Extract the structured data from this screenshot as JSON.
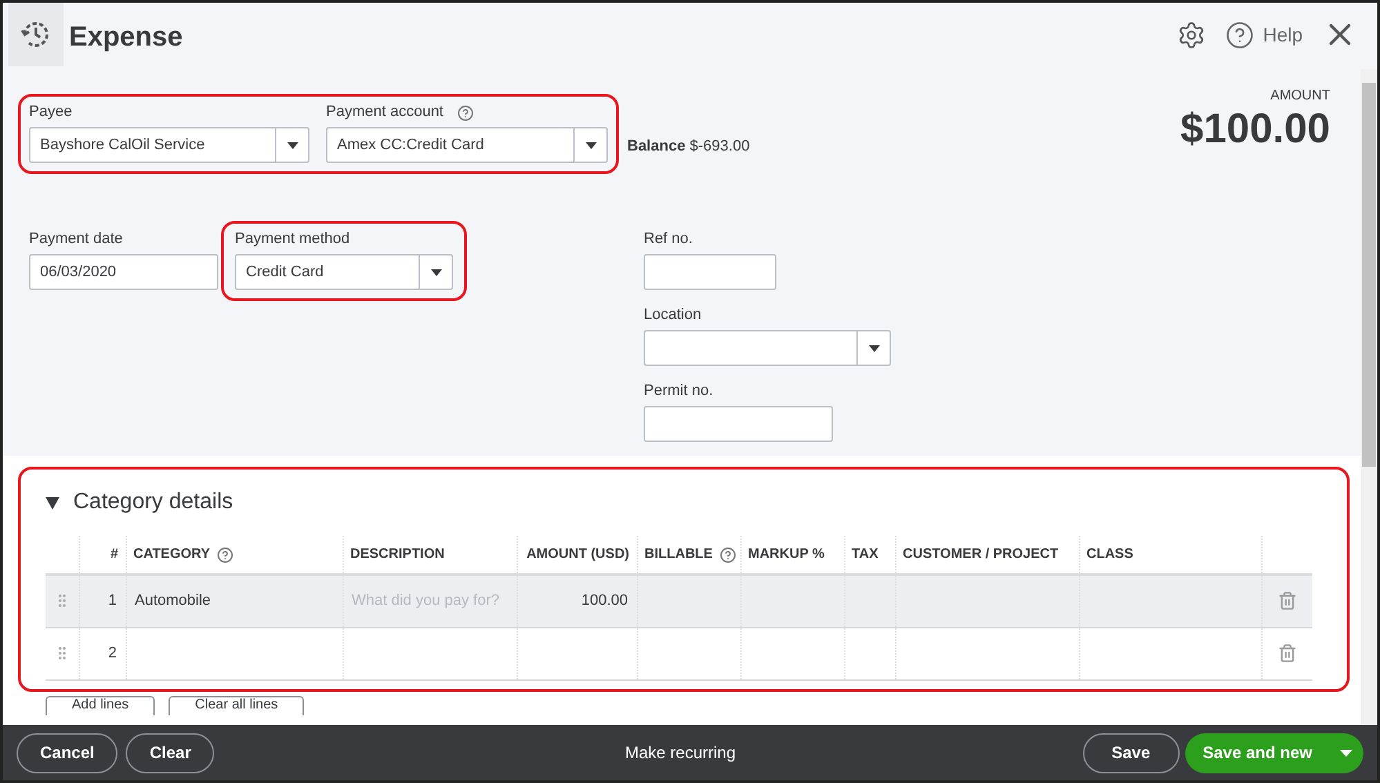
{
  "header": {
    "title": "Expense",
    "help": "Help"
  },
  "amount": {
    "label": "AMOUNT",
    "value": "$100.00"
  },
  "payee": {
    "label": "Payee",
    "value": "Bayshore CalOil Service"
  },
  "payment_account": {
    "label": "Payment account",
    "value": "Amex CC:Credit Card"
  },
  "balance": {
    "label": "Balance",
    "value": "$-693.00"
  },
  "payment_date": {
    "label": "Payment date",
    "value": "06/03/2020"
  },
  "payment_method": {
    "label": "Payment method",
    "value": "Credit Card"
  },
  "ref_no": {
    "label": "Ref no."
  },
  "location": {
    "label": "Location"
  },
  "permit_no": {
    "label": "Permit no."
  },
  "category_details": {
    "title": "Category details",
    "expanded": true,
    "columns": [
      {
        "label": "#",
        "help": false
      },
      {
        "label": "CATEGORY",
        "help": true
      },
      {
        "label": "DESCRIPTION",
        "help": false
      },
      {
        "label": "AMOUNT (USD)",
        "help": false
      },
      {
        "label": "BILLABLE",
        "help": true
      },
      {
        "label": "MARKUP %",
        "help": false
      },
      {
        "label": "TAX",
        "help": false
      },
      {
        "label": "CUSTOMER / PROJECT",
        "help": false
      },
      {
        "label": "CLASS",
        "help": false
      }
    ],
    "rows": [
      {
        "number": "1",
        "category": "Automobile",
        "description_placeholder": "What did you pay for?",
        "amount": "100.00",
        "selected": true
      },
      {
        "number": "2",
        "selected": false
      }
    ],
    "buttons": [
      "Add lines",
      "Clear all lines"
    ]
  },
  "footer": {
    "left_buttons": [
      "Cancel",
      "Clear"
    ],
    "center": "Make recurring",
    "save": "Save",
    "save_new": "Save and new"
  }
}
